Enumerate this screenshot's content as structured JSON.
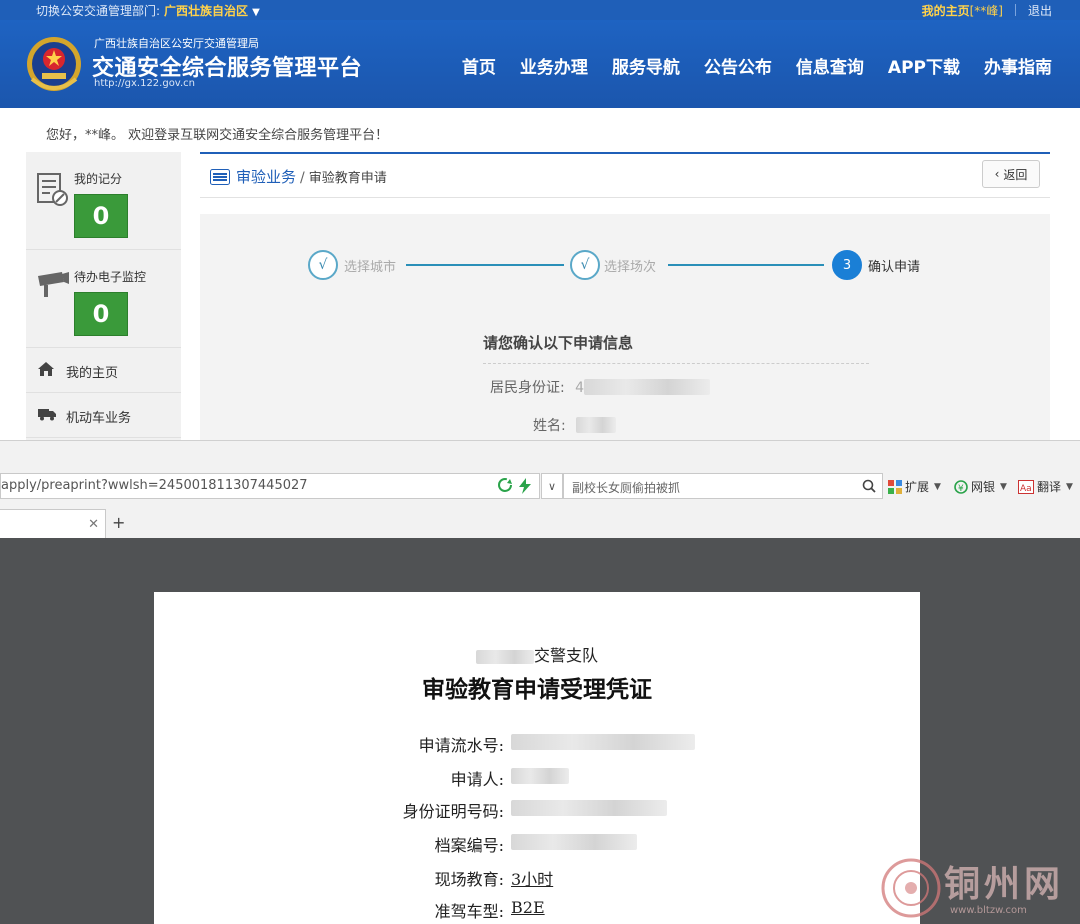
{
  "topbar": {
    "switch_label": "切换公安交通管理部门:",
    "region": "广西壮族自治区",
    "my_home": "我的主页",
    "user": "[**峰]",
    "logout": "退出"
  },
  "header": {
    "subtitle": "广西壮族自治区公安厅交通管理局",
    "title": "交通安全综合服务管理平台",
    "url": "http://gx.122.gov.cn",
    "nav": [
      "首页",
      "业务办理",
      "服务导航",
      "公告公布",
      "信息查询",
      "APP下载",
      "办事指南"
    ]
  },
  "welcome": "您好，**峰。 欢迎登录互联网交通安全综合服务管理平台！",
  "sidebar": {
    "score_label": "我的记分",
    "score_value": "0",
    "monitor_label": "待办电子监控",
    "monitor_value": "0",
    "menu": [
      "我的主页",
      "机动车业务"
    ]
  },
  "breadcrumb": {
    "section": "审验业务",
    "page": "审验教育申请",
    "back": "返回"
  },
  "steps": [
    {
      "mark": "√",
      "label": "选择城市",
      "state": "done"
    },
    {
      "mark": "√",
      "label": "选择场次",
      "state": "done"
    },
    {
      "mark": "3",
      "label": "确认申请",
      "state": "active"
    }
  ],
  "confirm": {
    "title": "请您确认以下申请信息",
    "id_label": "居民身份证:",
    "id_value_prefix": "4",
    "name_label": "姓名:"
  },
  "browser": {
    "url": "apply/preaprint?wwlsh=245001811307445027",
    "search_text": "副校长女厕偷拍被抓",
    "extensions": [
      "扩展",
      "网银",
      "翻译"
    ]
  },
  "certificate": {
    "unit": "交警支队",
    "title": "审验教育申请受理凭证",
    "rows": [
      {
        "label": "申请流水号:",
        "value": ""
      },
      {
        "label": "申请人:",
        "value": ""
      },
      {
        "label": "身份证明号码:",
        "value": ""
      },
      {
        "label": "档案编号:",
        "value": ""
      },
      {
        "label": "现场教育:",
        "value": "3小时"
      },
      {
        "label": "准驾车型:",
        "value": "B2E"
      }
    ]
  },
  "watermark": {
    "name": "铜州网",
    "url": "www.bltzw.com"
  },
  "colors": {
    "brand_blue": "#1f5fb8",
    "accent_yellow": "#ffd24a",
    "score_green": "#3a9a3a",
    "step_active": "#1a7fd6"
  }
}
